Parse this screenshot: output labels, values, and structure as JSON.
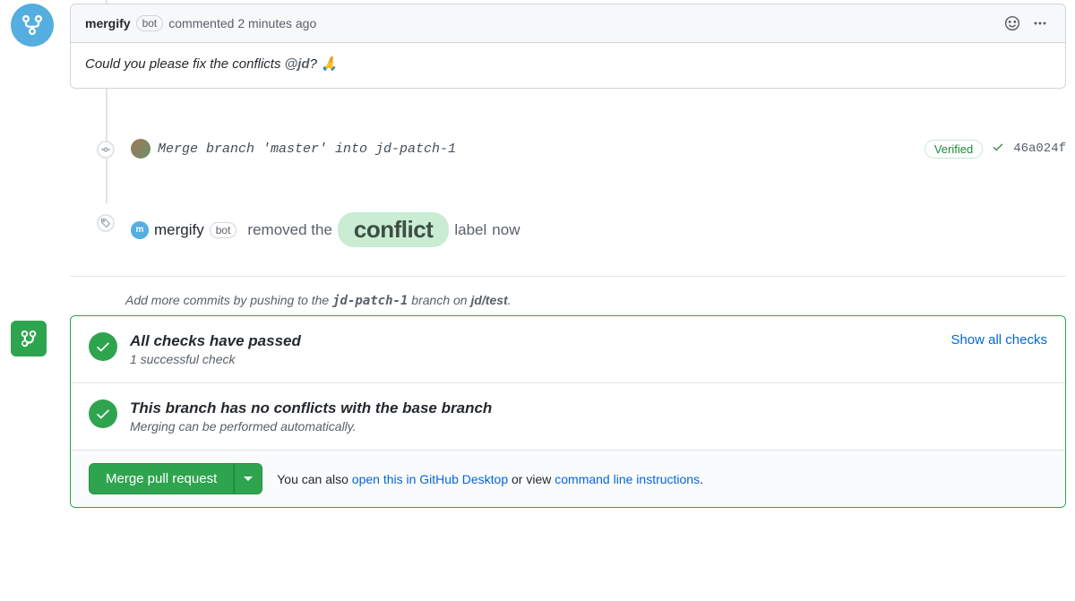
{
  "comment": {
    "author": "mergify",
    "bot_label": "bot",
    "action_text": "commented",
    "timestamp": "2 minutes ago",
    "body_prefix": "Could you please fix the conflicts ",
    "mention": "@jd",
    "body_suffix": "? 🙏"
  },
  "commit": {
    "message": "Merge branch 'master' into jd-patch-1",
    "verified_label": "Verified",
    "sha": "46a024f"
  },
  "label_event": {
    "actor": "mergify",
    "bot_label": "bot",
    "action_prefix": "removed the",
    "label_name": "conflict",
    "action_suffix": "label",
    "timestamp": "now"
  },
  "hint": {
    "prefix": "Add more commits by pushing to the ",
    "branch": "jd-patch-1",
    "middle": " branch on ",
    "repo": "jd/test",
    "suffix": "."
  },
  "merge": {
    "checks_title": "All checks have passed",
    "checks_sub": "1 successful check",
    "show_all": "Show all checks",
    "conflict_title": "This branch has no conflicts with the base branch",
    "conflict_sub": "Merging can be performed automatically.",
    "button": "Merge pull request",
    "alt_prefix": "You can also ",
    "alt_link1": "open this in GitHub Desktop",
    "alt_mid": " or view ",
    "alt_link2": "command line instructions",
    "alt_suffix": "."
  }
}
